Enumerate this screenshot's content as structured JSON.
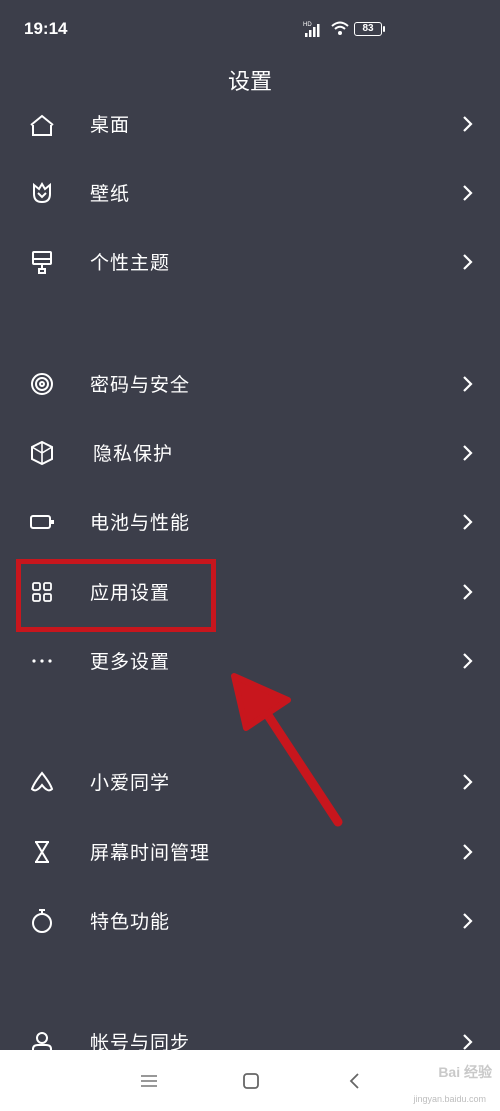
{
  "status_bar": {
    "time": "19:14",
    "network": "HD",
    "battery": "83"
  },
  "header": {
    "title": "设置"
  },
  "groups": [
    {
      "items": [
        {
          "label": "桌面",
          "icon": "home-icon"
        },
        {
          "label": "壁纸",
          "icon": "wallpaper-icon"
        },
        {
          "label": "个性主题",
          "icon": "theme-brush-icon"
        }
      ]
    },
    {
      "items": [
        {
          "label": "密码与安全",
          "icon": "fingerprint-icon"
        },
        {
          "label": "隐私保护",
          "icon": "privacy-shield-icon"
        },
        {
          "label": "电池与性能",
          "icon": "battery-icon"
        },
        {
          "label": "应用设置",
          "icon": "apps-grid-icon"
        },
        {
          "label": "更多设置",
          "icon": "more-dots-icon"
        }
      ]
    },
    {
      "items": [
        {
          "label": "小爱同学",
          "icon": "xiaoai-icon"
        },
        {
          "label": "屏幕时间管理",
          "icon": "hourglass-icon"
        },
        {
          "label": "特色功能",
          "icon": "stopwatch-icon"
        }
      ]
    },
    {
      "items": [
        {
          "label": "帐号与同步",
          "icon": "account-icon"
        }
      ]
    }
  ],
  "nav_bar": {
    "buttons": [
      "menu-icon",
      "home-square-icon",
      "back-icon"
    ]
  },
  "watermark": {
    "main": "Bai 经验",
    "sub": "jingyan.baidu.com"
  },
  "colors": {
    "background": "#3c3e4a",
    "text": "#ffffff",
    "annotation_red": "#c8161d",
    "nav_bar": "#ffffff"
  }
}
